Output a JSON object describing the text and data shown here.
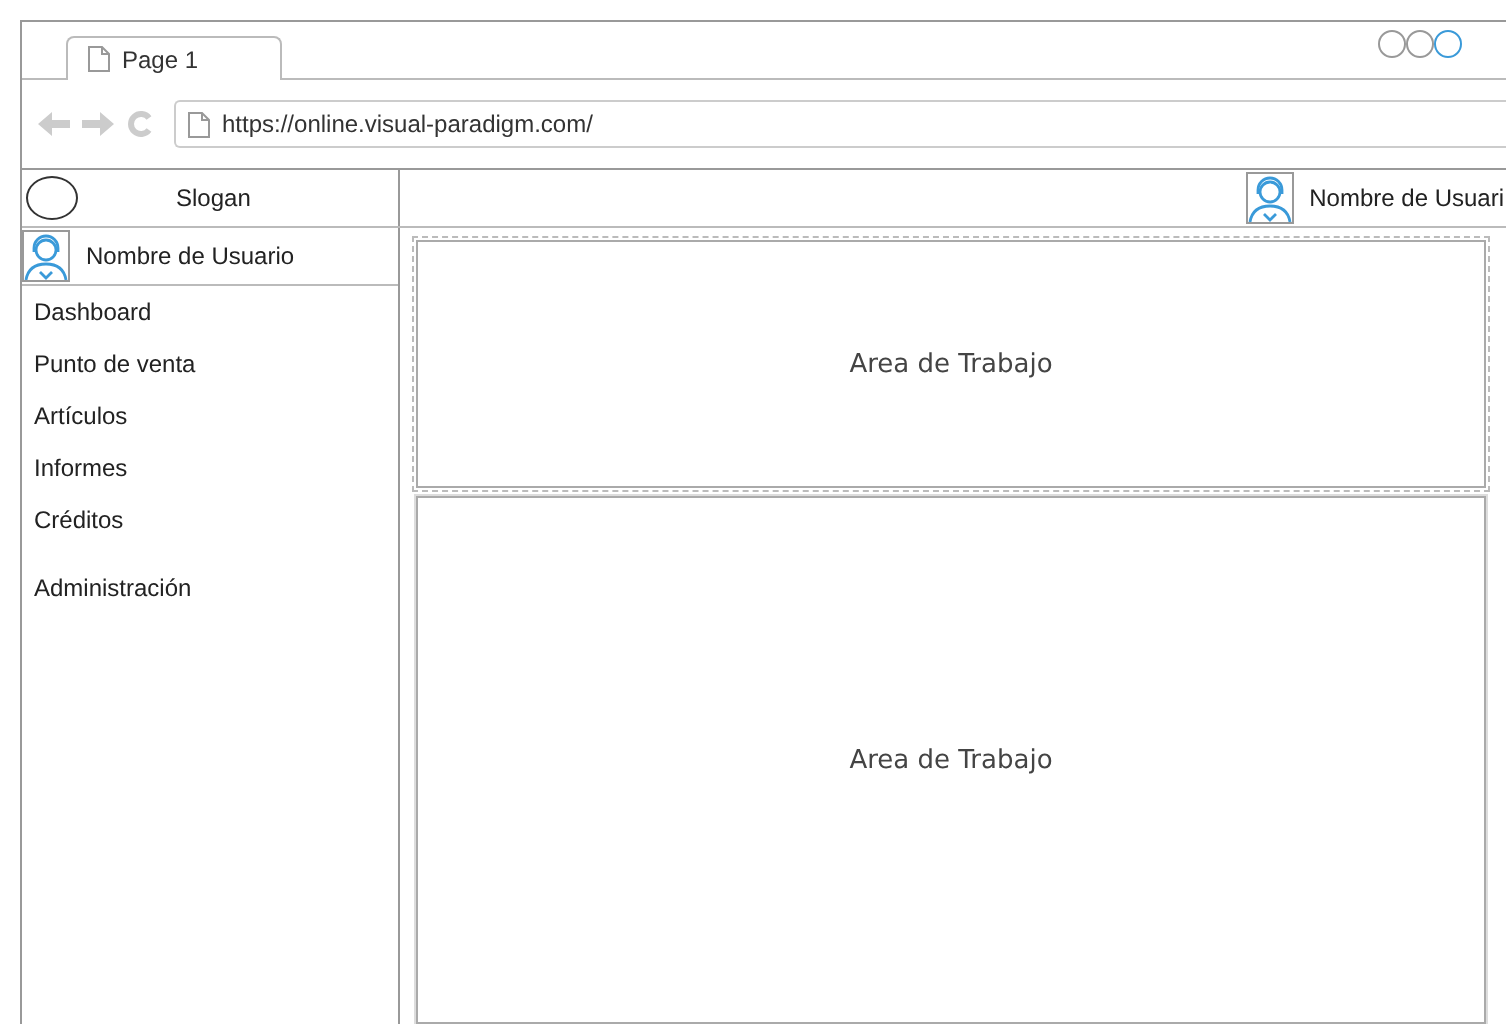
{
  "browser": {
    "tab": {
      "title": "Page 1"
    },
    "address": "https://online.visual-paradigm.com/"
  },
  "header": {
    "logo_text": "Slogan",
    "user_name": "Nombre de Usuari"
  },
  "sidebar": {
    "user_name": "Nombre de Usuario",
    "items": [
      {
        "label": "Dashboard"
      },
      {
        "label": "Punto de venta"
      },
      {
        "label": "Artículos"
      },
      {
        "label": "Informes"
      },
      {
        "label": "Créditos"
      },
      {
        "label": "Administración"
      }
    ]
  },
  "workspace": {
    "panels": [
      {
        "label": "Area de Trabajo",
        "kind": "dashed"
      },
      {
        "label": "Area de Trabajo",
        "kind": "solid"
      }
    ]
  }
}
